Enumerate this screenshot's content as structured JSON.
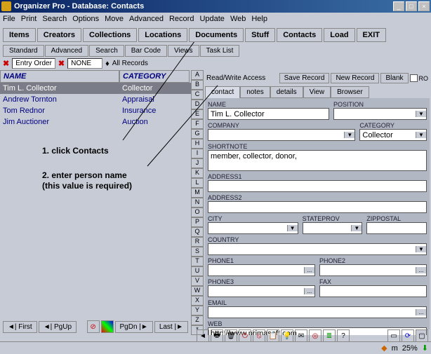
{
  "window": {
    "title": "Organizer Pro - Database: Contacts",
    "min_icon": "_",
    "max_icon": "□",
    "close_icon": "×"
  },
  "menubar": [
    "File",
    "Print",
    "Search",
    "Options",
    "Move",
    "Advanced",
    "Record",
    "Update",
    "Web",
    "Help"
  ],
  "toolbar_buttons": [
    "Items",
    "Creators",
    "Collections",
    "Locations",
    "Documents",
    "Stuff",
    "Contacts",
    "Load",
    "EXIT"
  ],
  "tabs": [
    "Standard",
    "Advanced",
    "Search",
    "Bar Code",
    "Views",
    "Task List"
  ],
  "subbar": {
    "entry_order": "Entry Order",
    "none": "NONE",
    "all_records": "All Records"
  },
  "list": {
    "headers": {
      "name": "NAME",
      "category": "CATEGORY"
    },
    "rows": [
      {
        "name": "Tim L. Collector",
        "category": "Collector",
        "selected": true
      },
      {
        "name": "Andrew Tornton",
        "category": "Appraisal",
        "selected": false
      },
      {
        "name": "Tom Rednor",
        "category": "Insurance",
        "selected": false
      },
      {
        "name": "Jim Auctioner",
        "category": "Auction",
        "selected": false
      }
    ]
  },
  "annotations": {
    "line1": "1. click Contacts",
    "line2a": "2. enter person name",
    "line2b": "(this value is required)"
  },
  "letters": [
    "A",
    "B",
    "C",
    "D",
    "E",
    "F",
    "G",
    "H",
    "I",
    "J",
    "K",
    "L",
    "M",
    "N",
    "O",
    "P",
    "Q",
    "R",
    "S",
    "T",
    "U",
    "V",
    "W",
    "X",
    "Y",
    "Z",
    "*"
  ],
  "rw_bar": {
    "label": "Read/Write Access",
    "save": "Save Record",
    "new": "New Record",
    "blank": "Blank",
    "ro": "RO"
  },
  "form_tabs": [
    "contact",
    "notes",
    "details",
    "View",
    "Browser"
  ],
  "form": {
    "name_label": "NAME",
    "name_value": "Tim L. Collector",
    "position_label": "POSITION",
    "position_value": "",
    "company_label": "COMPANY",
    "company_value": "",
    "category_label": "CATEGORY",
    "category_value": "Collector",
    "shortnote_label": "SHORTNOTE",
    "shortnote_value": "member, collector, donor,",
    "address1_label": "ADDRESS1",
    "address1_value": "",
    "address2_label": "ADDRESS2",
    "address2_value": "",
    "city_label": "CITY",
    "city_value": "",
    "stateprov_label": "STATEPROV",
    "stateprov_value": "",
    "zippostal_label": "ZIPPOSTAL",
    "zippostal_value": "",
    "country_label": "COUNTRY",
    "country_value": "",
    "phone1_label": "PHONE1",
    "phone1_value": "",
    "phone2_label": "PHONE2",
    "phone2_value": "",
    "phone3_label": "PHONE3",
    "phone3_value": "",
    "fax_label": "FAX",
    "fax_value": "",
    "email_label": "EMAIL",
    "email_value": "",
    "web_label": "WEB",
    "web_value": "http://www.primasoft.com"
  },
  "nav": {
    "first": "◄| First",
    "pgup": "◄| PgUp",
    "pgdn": "PgDn |►",
    "last": "Last |►"
  },
  "status": {
    "percent": "25%",
    "m": "m"
  }
}
